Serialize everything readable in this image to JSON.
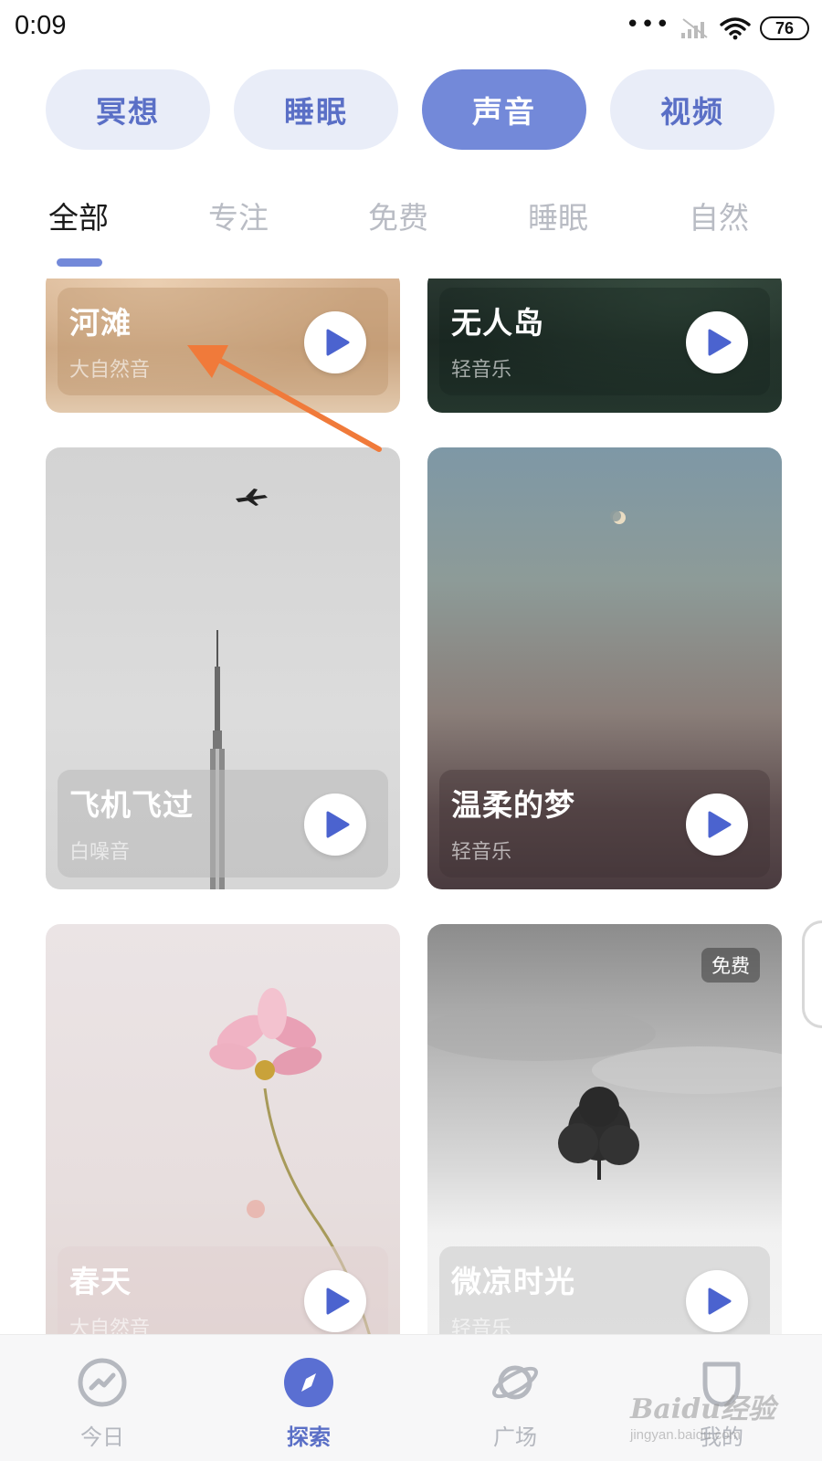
{
  "status_bar": {
    "time": "0:09",
    "dots": "•••",
    "battery": "76"
  },
  "pills": [
    {
      "label": "冥想",
      "active": false
    },
    {
      "label": "睡眠",
      "active": false
    },
    {
      "label": "声音",
      "active": true
    },
    {
      "label": "视频",
      "active": false
    }
  ],
  "subtabs": [
    {
      "label": "全部",
      "active": true
    },
    {
      "label": "专注",
      "active": false
    },
    {
      "label": "免费",
      "active": false
    },
    {
      "label": "睡眠",
      "active": false
    },
    {
      "label": "自然",
      "active": false
    }
  ],
  "cards": [
    {
      "title": "河滩",
      "subtitle": "大自然音",
      "image": "beach-sand"
    },
    {
      "title": "无人岛",
      "subtitle": "轻音乐",
      "image": "dark-forest"
    },
    {
      "title": "飞机飞过",
      "subtitle": "白噪音",
      "image": "airplane-tower"
    },
    {
      "title": "温柔的梦",
      "subtitle": "轻音乐",
      "image": "moon-dusk"
    },
    {
      "title": "春天",
      "subtitle": "大自然音",
      "image": "pink-flower"
    },
    {
      "title": "微凉时光",
      "subtitle": "轻音乐",
      "image": "lone-tree-snow",
      "badge": "免费"
    }
  ],
  "bottom_nav": [
    {
      "label": "今日",
      "icon": "trend-icon",
      "active": false
    },
    {
      "label": "探索",
      "icon": "compass-icon",
      "active": true
    },
    {
      "label": "广场",
      "icon": "planet-icon",
      "active": false
    },
    {
      "label": "我的",
      "icon": "profile-icon",
      "active": false
    }
  ],
  "watermark": {
    "main": "Baidu经验",
    "sub": "jingyan.baidu.com"
  },
  "colors": {
    "accent": "#7389d9",
    "accent_text": "#5a6fc6",
    "pill_bg": "#e9edf8",
    "annotation_arrow": "#f07a3a"
  }
}
